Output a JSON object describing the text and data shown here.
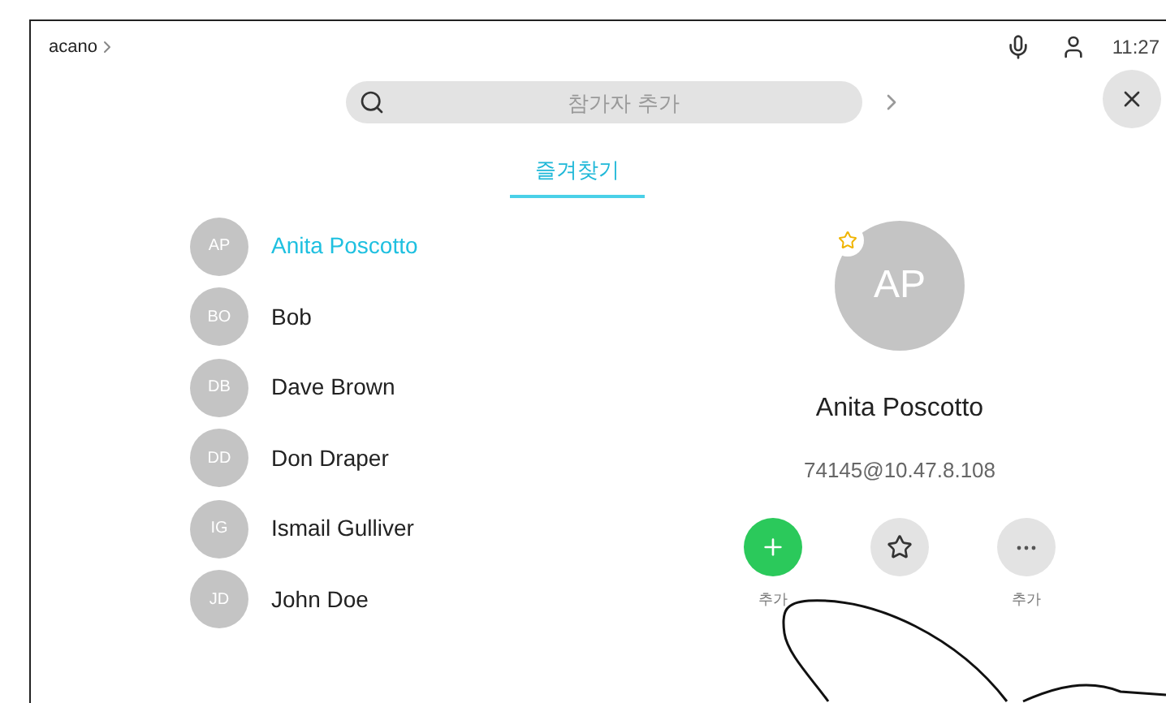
{
  "status_bar": {
    "system_name": "acano",
    "time": "11:27"
  },
  "search": {
    "placeholder": "참가자 추가"
  },
  "tabs": [
    {
      "label": "즐겨찾기",
      "selected": true
    }
  ],
  "contacts": [
    {
      "initials": "AP",
      "name": "Anita Poscotto",
      "selected": true
    },
    {
      "initials": "BO",
      "name": "Bob",
      "selected": false
    },
    {
      "initials": "DB",
      "name": "Dave Brown",
      "selected": false
    },
    {
      "initials": "DD",
      "name": "Don Draper",
      "selected": false
    },
    {
      "initials": "IG",
      "name": "Ismail Gulliver",
      "selected": false
    },
    {
      "initials": "JD",
      "name": "John Doe",
      "selected": false
    }
  ],
  "detail": {
    "initials": "AP",
    "favorite": true,
    "name": "Anita Poscotto",
    "address": "74145@10.47.8.108",
    "actions": [
      {
        "kind": "call",
        "label": "추가"
      },
      {
        "kind": "favorite"
      },
      {
        "kind": "more",
        "label": "추가"
      }
    ]
  }
}
